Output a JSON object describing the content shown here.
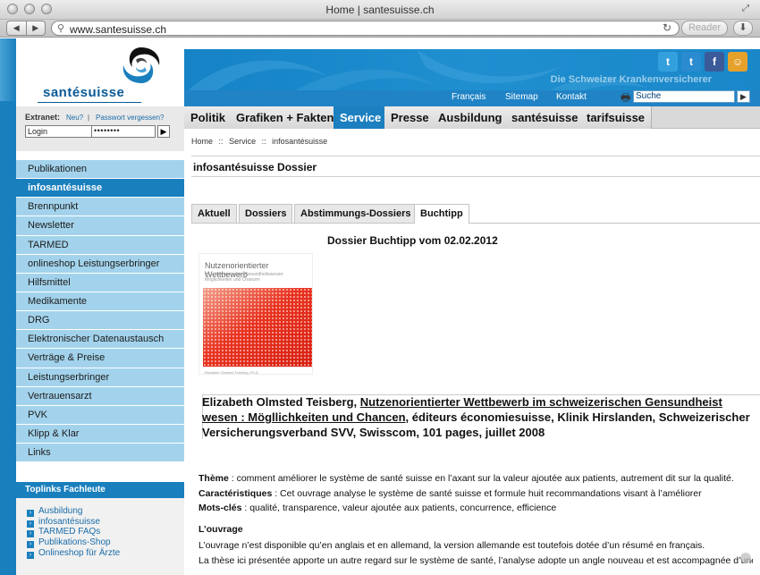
{
  "window": {
    "title": "Home | santesuisse.ch"
  },
  "browser": {
    "url": "www.santesuisse.ch",
    "reader_label": "Reader",
    "back_glyph": "◀",
    "forward_glyph": "▶",
    "icons": {
      "url": "search-icon",
      "reload": "reload-icon",
      "download": "download-icon"
    }
  },
  "site": {
    "logo_text": "santésuisse",
    "tagline": "Die Schweizer Krankenversicherer",
    "top_links": [
      "Français",
      "Sitemap",
      "Kontakt"
    ],
    "search_placeholder": "Suche",
    "social": [
      {
        "name": "twitter",
        "glyph": "t",
        "color": "#33a0dd"
      },
      {
        "name": "twitter",
        "glyph": "t",
        "color": "#2a8bd1"
      },
      {
        "name": "facebook",
        "glyph": "f",
        "color": "#3b5a9a"
      },
      {
        "name": "other",
        "glyph": "☺",
        "color": "#e6a12b"
      }
    ],
    "colors": {
      "brand_blue": "#1a7fbd",
      "side_light": "#a3d3ec"
    }
  },
  "mainnav": [
    {
      "label": "Politik",
      "active": false
    },
    {
      "label": "Grafiken + Fakten",
      "active": false
    },
    {
      "label": "Service",
      "active": true
    },
    {
      "label": "Presse",
      "active": false
    },
    {
      "label": "Ausbildung",
      "active": false
    },
    {
      "label": "santésuisse",
      "active": false
    },
    {
      "label": "tarifsuisse",
      "active": false
    }
  ],
  "extranet": {
    "label": "Extranet:",
    "new_link": "Neu?",
    "forgot_link": "Passwort vergessen?",
    "login_value": "Login",
    "password_value": "••••••••"
  },
  "sidebar": {
    "items": [
      {
        "label": "Publikationen",
        "active": false
      },
      {
        "label": "infosantésuisse",
        "active": true
      },
      {
        "label": "Brennpunkt",
        "active": false
      },
      {
        "label": "Newsletter",
        "active": false
      },
      {
        "label": "TARMED",
        "active": false
      },
      {
        "label": "onlineshop Leistungserbringer",
        "active": false
      },
      {
        "label": "Hilfsmittel",
        "active": false
      },
      {
        "label": "Medikamente",
        "active": false
      },
      {
        "label": "DRG",
        "active": false
      },
      {
        "label": "Elektronischer Datenaustausch",
        "active": false
      },
      {
        "label": "Verträge & Preise",
        "active": false
      },
      {
        "label": "Leistungserbringer",
        "active": false
      },
      {
        "label": "Vertrauensarzt",
        "active": false
      },
      {
        "label": "PVK",
        "active": false
      },
      {
        "label": "Klipp & Klar",
        "active": false
      },
      {
        "label": "Links",
        "active": false
      }
    ]
  },
  "toplinks": {
    "heading": "Toplinks Fachleute",
    "items": [
      "Ausbildung",
      "infosantésuisse",
      "TARMED FAQs",
      "Publikations-Shop",
      "Onlineshop für Ärzte"
    ]
  },
  "breadcrumb": [
    "Home",
    "::",
    "Service",
    "::",
    "infosantésuisse"
  ],
  "content": {
    "title": "infosantésuisse Dossier",
    "tabs": [
      {
        "label": "Aktuell",
        "active": false
      },
      {
        "label": "Dossiers",
        "active": false
      },
      {
        "label": "Abstimmungs-Dossiers",
        "active": false
      },
      {
        "label": "Buchtipp",
        "active": true
      }
    ],
    "dossier_heading": "Dossier Buchtipp vom 02.02.2012",
    "book": {
      "cover_title": "Nutzenorientierter Wettbewerb",
      "cover_subtitle": "im schweizerischen Gesundheitswesen: Möglichkeiten und Chancen",
      "cover_footer": "Elizabeth Olmsted Teisberg, Ph.D."
    },
    "reference": {
      "author": "Elizabeth Olmsted Teisberg,",
      "title": "Nutzenorientierter Wettbewerb im schweizerischen Gensundheist wesen : Mögllichkeiten und Chancen,",
      "rest": " éditeurs économiesuisse, Klinik Hirslanden, Schweizerischer Versicherungsverband SVV, Swisscom, 101 pages, juillet 2008"
    },
    "theme_label": "Thème",
    "theme_text": " : comment améliorer le système de santé suisse en l’axant sur la valeur ajoutée aux patients, autrement dit sur la qualité.",
    "caract_label": "Caractéristiques",
    "caract_text": " : Cet ouvrage analyse le système de santé suisse et formule huit recommandations visant à l’améliorer",
    "mots_label": "Mots-clés",
    "mots_text": " : qualité, transparence, valeur ajoutée aux patients, concurrence, efficience",
    "ouvrage_heading": "L’ouvrage",
    "para1": "L’ouvrage n’est disponible qu’en anglais et en allemand, la version allemande est toutefois dotée d’un résumé en français.",
    "para2": "La thèse ici présentée apporte un autre regard sur le système de santé, l’analyse adopte un angle nouveau et est accompagnée d’une"
  }
}
